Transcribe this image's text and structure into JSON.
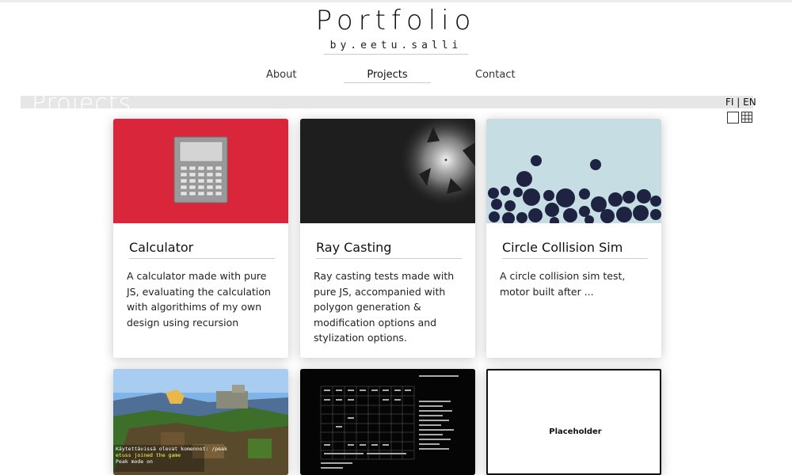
{
  "header": {
    "title": "Portfolio",
    "subtitle": "by.eetu.salli"
  },
  "nav": {
    "items": [
      {
        "label": "About"
      },
      {
        "label": "Projects"
      },
      {
        "label": "Contact"
      }
    ],
    "active": "Projects"
  },
  "section": {
    "title": "Projects"
  },
  "language": {
    "fi": "FI",
    "separator": "|",
    "en": "EN"
  },
  "projects": [
    {
      "title": "Calculator",
      "description": "A calculator made with pure JS, evaluating the calculation with algorithims of my own design using recursion",
      "thumb_color": "#d9263a"
    },
    {
      "title": "Ray Casting",
      "description": "Ray casting tests made with pure JS, accompanied with polygon generation & modification options and stylization options.",
      "thumb_color": "#1e1e1e"
    },
    {
      "title": "Circle Collision Sim",
      "description": "A circle collision sim test, motor built after ...",
      "thumb_color": "#c5dde3"
    }
  ],
  "preview_cards": [
    {
      "name": "minecraft",
      "chat_lines": [
        "Käytettävissä olevat komennot: /peak",
        "etuss joined the game",
        "Peak mode on"
      ]
    },
    {
      "name": "terminal-grid"
    },
    {
      "name": "placeholder",
      "label": "Placeholder"
    }
  ],
  "colors": {
    "calculator_bg": "#d9263a",
    "raycast_bg": "#1e1e1e",
    "circles_bg": "#c5dde3",
    "circle_fill": "#1d2340",
    "section_bar": "#e6e6e6"
  },
  "icons": {
    "single_view": "square-icon",
    "grid_view": "grid-icon"
  }
}
